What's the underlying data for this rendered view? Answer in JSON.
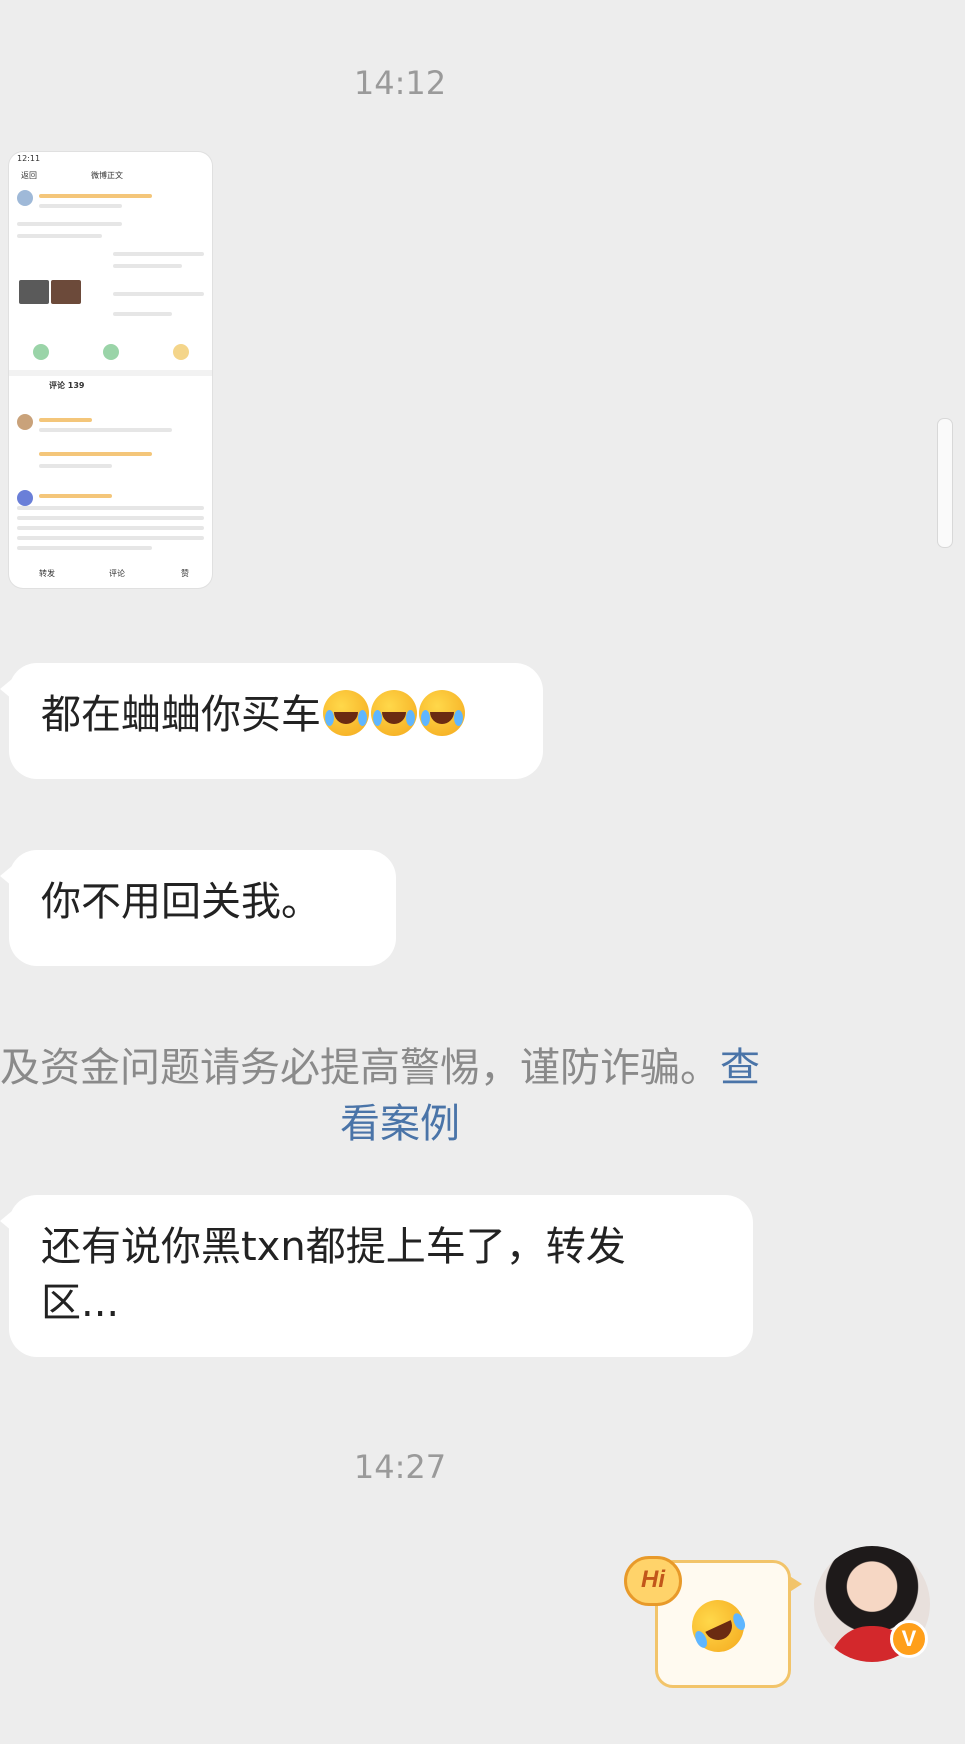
{
  "messages": {
    "timestamp_1": "14:12",
    "bubble_1_text": "都在蛐蛐你买车",
    "bubble_1_emojis": [
      "laughing-tears-emoji",
      "laughing-tears-emoji",
      "laughing-tears-emoji"
    ],
    "bubble_2_text": "你不用回关我。",
    "warning_text": "及资金问题请务必提高警惕，谨防诈骗。",
    "warning_link_part1": "查",
    "warning_link_part2": "看案例",
    "bubble_3_line1": "还有说你黑txn都提上车了，转发",
    "bubble_3_line2": "区...",
    "timestamp_2": "14:27",
    "sticker_hi": "Hi",
    "avatar_badge": "V"
  },
  "thumbnail": {
    "status_time": "12:11",
    "header_back": "返回",
    "header_title": "微博正文",
    "tab_comments": "评论 139",
    "footer_share": "转发",
    "footer_comment": "评论",
    "footer_like": "赞"
  }
}
